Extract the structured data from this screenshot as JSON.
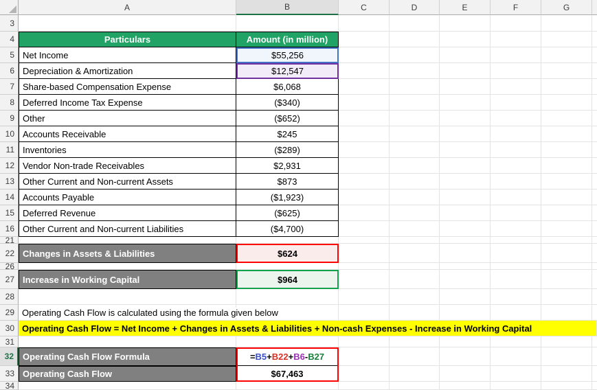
{
  "columns": [
    "A",
    "B",
    "C",
    "D",
    "E",
    "F",
    "G"
  ],
  "row_numbers": [
    "3",
    "4",
    "5",
    "6",
    "7",
    "8",
    "9",
    "10",
    "11",
    "12",
    "13",
    "14",
    "15",
    "16",
    "21",
    "22",
    "26",
    "27",
    "28",
    "29",
    "30",
    "31",
    "32",
    "33",
    "34"
  ],
  "table": {
    "header": {
      "particulars": "Particulars",
      "amount": "Amount (in million)"
    },
    "items": [
      {
        "label": "Net Income",
        "value": "$55,256"
      },
      {
        "label": "Depreciation & Amortization",
        "value": "$12,547"
      },
      {
        "label": "Share-based Compensation Expense",
        "value": "$6,068"
      },
      {
        "label": "Deferred Income Tax Expense",
        "value": "($340)"
      },
      {
        "label": "Other",
        "value": "($652)"
      },
      {
        "label": "Accounts Receivable",
        "value": "$245"
      },
      {
        "label": "Inventories",
        "value": "($289)"
      },
      {
        "label": "Vendor Non-trade Receivables",
        "value": "$2,931"
      },
      {
        "label": "Other Current and Non-current Assets",
        "value": "$873"
      },
      {
        "label": "Accounts Payable",
        "value": "($1,923)"
      },
      {
        "label": "Deferred Revenue",
        "value": "($625)"
      },
      {
        "label": "Other Current and Non-current Liabilities",
        "value": "($4,700)"
      }
    ]
  },
  "summary": {
    "changes_label": "Changes in Assets & Liabilities",
    "changes_value": "$624",
    "wc_label": "Increase in Working Capital",
    "wc_value": "$964"
  },
  "notes": {
    "line1": "Operating Cash Flow is calculated using the formula given below",
    "line2": "Operating Cash Flow = Net Income + Changes in Assets & Liabilities + Non-cash Expenses - Increase in Working Capital"
  },
  "formula": {
    "label": "Operating Cash Flow Formula",
    "full": "=B5+B22+B6-B27",
    "parts": [
      {
        "text": "="
      },
      {
        "text": "B5"
      },
      {
        "text": "+"
      },
      {
        "text": "B22"
      },
      {
        "text": "+"
      },
      {
        "text": "B6"
      },
      {
        "text": "-"
      },
      {
        "text": "B27"
      }
    ],
    "result_label": "Operating Cash Flow",
    "result_value": "$67,463"
  },
  "colors": {
    "header_green": "#21A366",
    "label_gray": "#808080",
    "highlight_yellow": "#FFFF00",
    "ref_blue": "#3A4FC4",
    "ref_red": "#D93025",
    "ref_purple": "#9A30B5",
    "ref_green": "#188038",
    "box_red": "#FF0000",
    "box_green": "#13A14E",
    "ref_blue_border": "#4472C4",
    "ref_purple_border": "#7030A0"
  }
}
